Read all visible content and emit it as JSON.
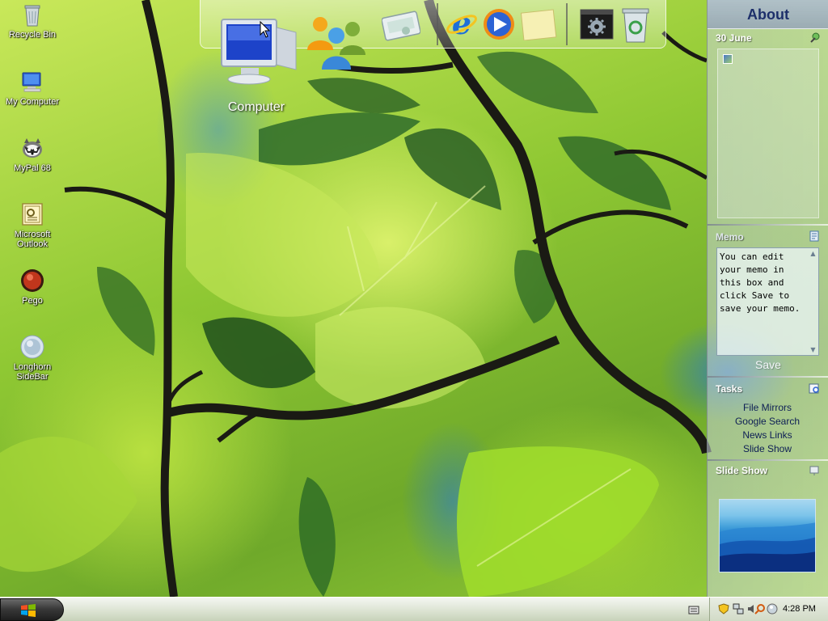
{
  "desktop": {
    "icons": [
      {
        "label": "Recycle Bin"
      },
      {
        "label": "My Computer"
      },
      {
        "label": "MyPal 68"
      },
      {
        "label": "Microsoft Outlook"
      },
      {
        "label": "Pego"
      },
      {
        "label": "Longhorn SideBar"
      }
    ],
    "computer_caption": "Computer"
  },
  "dock": {
    "items": [
      "computer-icon",
      "users-icon",
      "network-icon",
      "internet-explorer-icon",
      "media-player-icon",
      "sticky-note-icon",
      "settings-icon",
      "recycle-bin-icon"
    ]
  },
  "sidebar": {
    "about": "About",
    "date": "30 June",
    "memo_title": "Memo",
    "memo_text": "You can edit your memo in this box and click Save to save your memo.",
    "save_label": "Save",
    "tasks_title": "Tasks",
    "tasks": [
      "File Mirrors",
      "Google Search",
      "News Links",
      "Slide Show"
    ],
    "slideshow_title": "Slide Show"
  },
  "taskbar": {
    "clock": "4:28 PM"
  },
  "colors": {
    "taskbar": "#dfe6d6",
    "task_link": "#0d1e55",
    "about_title": "#1d2f6a"
  }
}
